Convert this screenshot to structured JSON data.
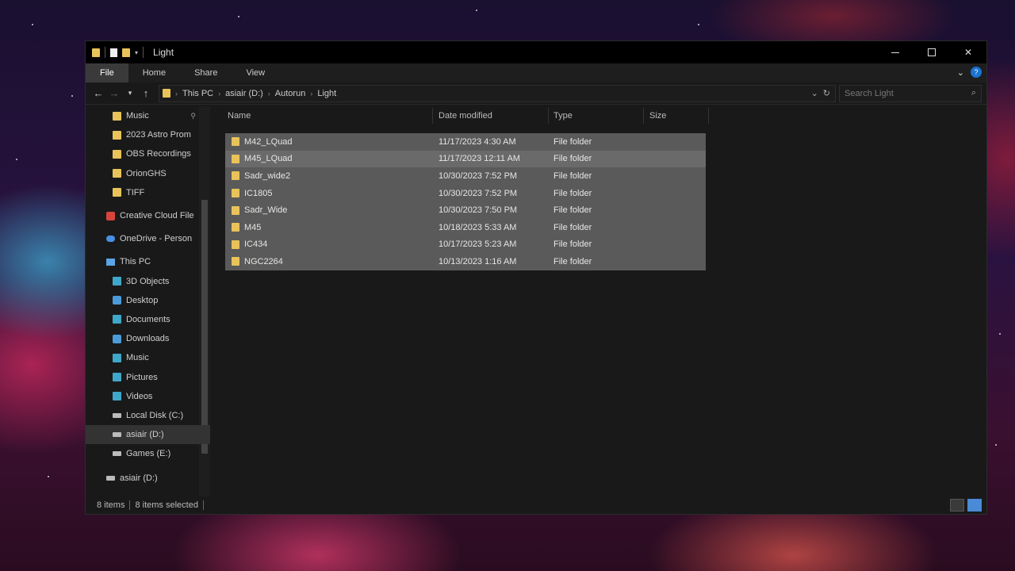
{
  "window": {
    "title": "Light"
  },
  "ribbon": {
    "tabs": [
      "File",
      "Home",
      "Share",
      "View"
    ],
    "help": "?"
  },
  "address": {
    "crumbs": [
      "This PC",
      "asiair (D:)",
      "Autorun",
      "Light"
    ],
    "search_placeholder": "Search Light"
  },
  "sidebar": {
    "items": [
      {
        "label": "Music",
        "icon": "folder-icon",
        "pinned": true
      },
      {
        "label": "2023 Astro Prom",
        "icon": "folder-icon"
      },
      {
        "label": "OBS Recordings",
        "icon": "folder-icon"
      },
      {
        "label": "OrionGHS",
        "icon": "folder-icon"
      },
      {
        "label": "TIFF",
        "icon": "folder-icon"
      },
      {
        "label": "Creative Cloud File",
        "icon": "creative-cloud-icon"
      },
      {
        "label": "OneDrive - Person",
        "icon": "onedrive-icon"
      },
      {
        "label": "This PC",
        "icon": "this-pc-icon"
      },
      {
        "label": "3D Objects",
        "icon": "3d-objects-icon"
      },
      {
        "label": "Desktop",
        "icon": "desktop-icon"
      },
      {
        "label": "Documents",
        "icon": "documents-icon"
      },
      {
        "label": "Downloads",
        "icon": "downloads-icon"
      },
      {
        "label": "Music",
        "icon": "music-icon"
      },
      {
        "label": "Pictures",
        "icon": "pictures-icon"
      },
      {
        "label": "Videos",
        "icon": "videos-icon"
      },
      {
        "label": "Local Disk (C:)",
        "icon": "drive-icon"
      },
      {
        "label": "asiair (D:)",
        "icon": "drive-icon",
        "selected": true
      },
      {
        "label": "Games (E:)",
        "icon": "drive-icon"
      },
      {
        "label": "asiair (D:)",
        "icon": "drive-icon"
      }
    ]
  },
  "columns": [
    "Name",
    "Date modified",
    "Type",
    "Size"
  ],
  "files": [
    {
      "name": "M42_LQuad",
      "date": "11/17/2023 4:30 AM",
      "type": "File folder"
    },
    {
      "name": "M45_LQuad",
      "date": "11/17/2023 12:11 AM",
      "type": "File folder"
    },
    {
      "name": "Sadr_wide2",
      "date": "10/30/2023 7:52 PM",
      "type": "File folder"
    },
    {
      "name": "IC1805",
      "date": "10/30/2023 7:52 PM",
      "type": "File folder"
    },
    {
      "name": "Sadr_Wide",
      "date": "10/30/2023 7:50 PM",
      "type": "File folder"
    },
    {
      "name": "M45",
      "date": "10/18/2023 5:33 AM",
      "type": "File folder"
    },
    {
      "name": "IC434",
      "date": "10/17/2023 5:23 AM",
      "type": "File folder"
    },
    {
      "name": "NGC2264",
      "date": "10/13/2023 1:16 AM",
      "type": "File folder"
    }
  ],
  "status": {
    "count": "8 items",
    "selected": "8 items selected"
  }
}
